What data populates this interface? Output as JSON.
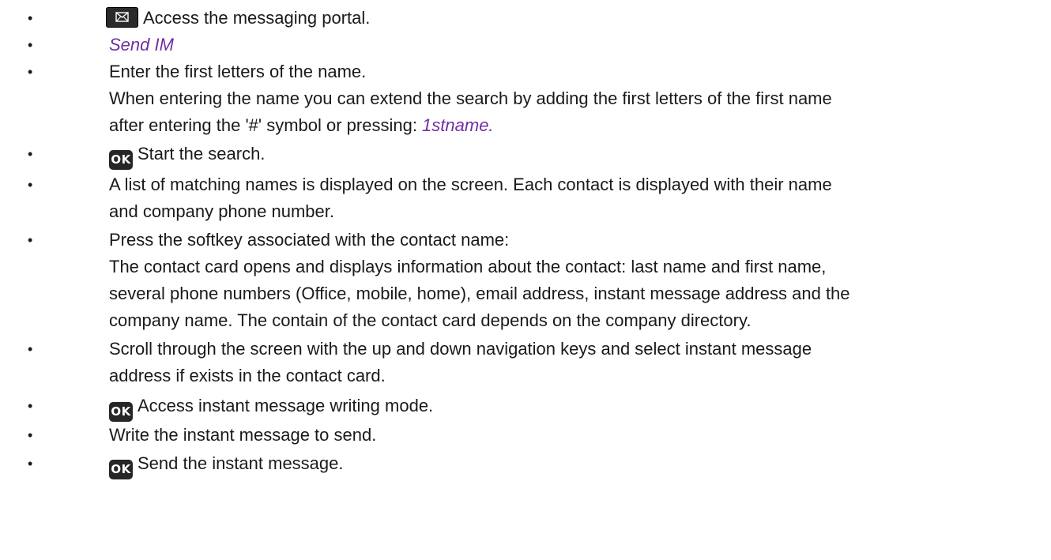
{
  "bullet_glyph": "•",
  "items": [
    {
      "icon": "envelope-icon",
      "lines": [
        "Access the messaging portal."
      ]
    },
    {
      "italic": "Send IM"
    },
    {
      "lines": [
        "Enter the first letters of the name.",
        "When entering the name you can extend the search by adding the first letters of the first name",
        "after entering the '#' symbol or pressing: "
      ],
      "italic_tail": "1stname."
    },
    {
      "icon": "ok-key-icon",
      "icon_label": "OK",
      "lines": [
        "Start the search."
      ]
    },
    {
      "lines": [
        "A list of matching names is displayed on the screen. Each contact is displayed with their name",
        "and company phone number."
      ]
    },
    {
      "lines": [
        "Press the softkey associated with the contact name:",
        "The contact card opens and displays information about the contact: last name and first name,",
        "several phone numbers (Office, mobile, home), email address, instant message address and the",
        "company name. The contain of the contact card depends on the company directory."
      ]
    },
    {
      "lines": [
        "Scroll through the screen with the up and down navigation keys and select instant message",
        "address if exists in the contact card."
      ]
    },
    {
      "icon": "ok-key-icon",
      "icon_label": "OK",
      "lines": [
        "Access instant message writing mode."
      ]
    },
    {
      "lines": [
        "Write the instant message to send."
      ]
    },
    {
      "icon": "ok-key-icon",
      "icon_label": "OK",
      "lines": [
        "Send the instant message."
      ]
    }
  ]
}
